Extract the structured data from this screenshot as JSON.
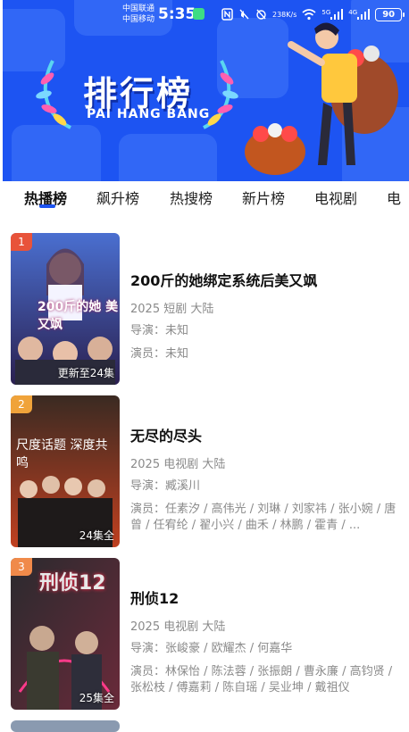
{
  "status_bar": {
    "carrier_1": "中国联通",
    "carrier_2": "中国移动",
    "time": "5:35",
    "net_speed": "238",
    "net_unit": "K/s",
    "battery": "90",
    "signal_1_label": "5G",
    "signal_2_label": "4G"
  },
  "banner": {
    "title": "排行榜",
    "subtitle": "PAI HANG BANG"
  },
  "tabs": [
    {
      "label": "热播榜",
      "active": true
    },
    {
      "label": "飙升榜"
    },
    {
      "label": "热搜榜"
    },
    {
      "label": "新片榜"
    },
    {
      "label": "电视剧"
    },
    {
      "label": "电"
    }
  ],
  "items": [
    {
      "rank": "1",
      "rank_color": "#e8533a",
      "title": "200斤的她绑定系统后美又飒",
      "meta": "2025 短剧 大陆",
      "director": "导演：未知",
      "actors": "演员：未知",
      "note": "更新至24集",
      "poster_text": "200斤的她 美又飒"
    },
    {
      "rank": "2",
      "rank_color": "#f0a33a",
      "title": "无尽的尽头",
      "meta": "2025 电视剧 大陆",
      "director": "导演：臧溪川",
      "actors": "演员：任素汐 / 高伟光 / 刘琳 / 刘家祎 / 张小婉 / 唐曾 / 任宥纶 / 翟小兴 / 曲禾 / 林鹏 / 霍青 / ...",
      "note": "24集全",
      "poster_text": "尺度话题 深度共鸣"
    },
    {
      "rank": "3",
      "rank_color": "#f08a4a",
      "title": "刑侦12",
      "meta": "2025 电视剧 大陆",
      "director": "导演：张峻豪 / 欧耀杰 / 何嘉华",
      "actors": "演员：林保怡 / 陈法蓉 / 张振朗 / 曹永廉 / 高钧贤 / 张松枝 / 傅嘉莉 / 陈自瑶 / 吴业坤 / 戴祖仪",
      "note": "25集全",
      "poster_text": "刑侦12"
    }
  ],
  "colors": {
    "banner_bg": "#1d54f2",
    "tab_indicator": "#1d54f2"
  }
}
